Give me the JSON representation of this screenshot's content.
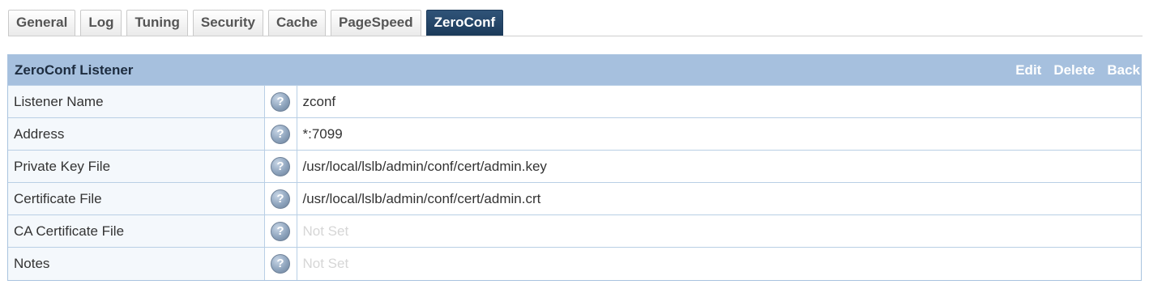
{
  "tabs": [
    "General",
    "Log",
    "Tuning",
    "Security",
    "Cache",
    "PageSpeed",
    "ZeroConf"
  ],
  "active_tab": "ZeroConf",
  "panel": {
    "title": "ZeroConf Listener",
    "actions": {
      "edit": "Edit",
      "delete": "Delete",
      "back": "Back"
    },
    "rows": [
      {
        "label": "Listener Name",
        "value": "zconf",
        "set": true
      },
      {
        "label": "Address",
        "value": "*:7099",
        "set": true
      },
      {
        "label": "Private Key File",
        "value": "/usr/local/lslb/admin/conf/cert/admin.key",
        "set": true
      },
      {
        "label": "Certificate File",
        "value": "/usr/local/lslb/admin/conf/cert/admin.crt",
        "set": true
      },
      {
        "label": "CA Certificate File",
        "value": "Not Set",
        "set": false
      },
      {
        "label": "Notes",
        "value": "Not Set",
        "set": false
      }
    ]
  },
  "icons": {
    "help": "help-icon"
  },
  "colors": {
    "header_bg": "#a6c0de",
    "active_tab_bg": "#1b3a5a",
    "not_set_text": "#d6d6d6"
  }
}
